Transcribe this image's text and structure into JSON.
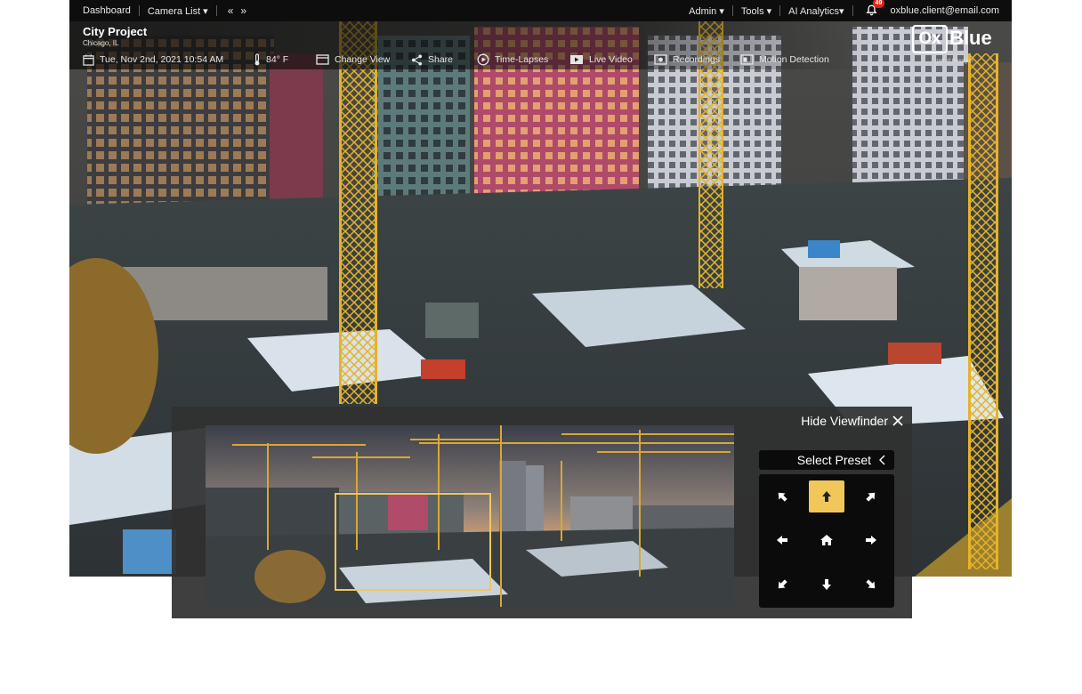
{
  "topbar": {
    "nav": {
      "dashboard": "Dashboard",
      "camera_list": "Camera List ▾",
      "prev": "«",
      "next": "»"
    },
    "admin": "Admin ▾",
    "tools": "Tools ▾",
    "ai_analytics": "AI Analytics▾",
    "notification_count": "49",
    "email": "oxblue.client@email.com"
  },
  "project": {
    "title": "City Project",
    "location": "Chicago, IL"
  },
  "toolbar": {
    "datetime": "Tue, Nov 2nd, 2021 10:54 AM",
    "temperature": "84° F",
    "change_view": "Change View",
    "share": "Share",
    "time_lapses": "Time-Lapses",
    "live_video": "Live Video",
    "recordings": "Recordings",
    "motion_detection": "Motion Detection"
  },
  "logo": {
    "box": "Ox",
    "word": "Blue",
    "sub": "part of Hexagon"
  },
  "viewfinder": {
    "hide_label": "Hide Viewfinder",
    "select_preset": "Select Preset",
    "active_direction": "up"
  },
  "colors": {
    "accent": "#f1c75b",
    "badge": "#e2231a",
    "crane": "#e4b329"
  },
  "icons": [
    "calendar-icon",
    "thermometer-icon",
    "change-view-icon",
    "share-icon",
    "time-lapse-icon",
    "live-video-icon",
    "recordings-icon",
    "motion-detection-icon",
    "bell-icon",
    "close-icon",
    "chevron-left-icon",
    "arrow-up-icon",
    "arrow-down-icon",
    "arrow-left-icon",
    "arrow-right-icon",
    "home-icon"
  ]
}
